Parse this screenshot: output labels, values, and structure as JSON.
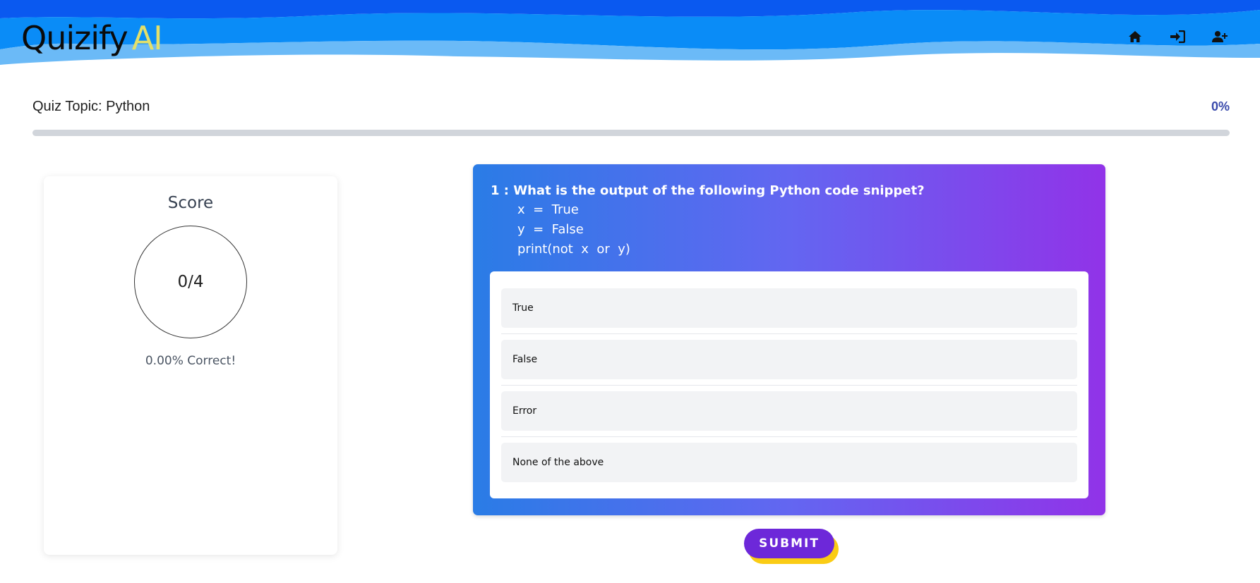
{
  "app": {
    "brand": "Quizify",
    "brand_suffix": "AI",
    "colors": {
      "wave_dark": "#0a59f0",
      "wave_mid": "#0a8cf7",
      "wave_light": "#6bbaf7",
      "ai_accent": "#e4e06a"
    }
  },
  "nav": [
    {
      "icon": "home-icon"
    },
    {
      "icon": "sign-in-icon"
    },
    {
      "icon": "user-plus-icon"
    }
  ],
  "quiz": {
    "topic": "Quiz Topic: Python",
    "progress_label": "0%",
    "progress_fraction": 0,
    "progress_color": "#3949ab"
  },
  "score": {
    "title": "Score",
    "value": "0/4",
    "percent_label": "0.00% Correct!"
  },
  "question": {
    "heading": "1 : What is the output of the following Python code snippet?",
    "code": [
      "x  =  True",
      "y  =  False",
      "print(not  x  or  y)"
    ],
    "options": [
      "True",
      "False",
      "Error",
      "None of the above"
    ],
    "gradient": [
      "#2a7ce6",
      "#6366f1",
      "#9133e8"
    ]
  },
  "submit_label": "SUBMIT"
}
